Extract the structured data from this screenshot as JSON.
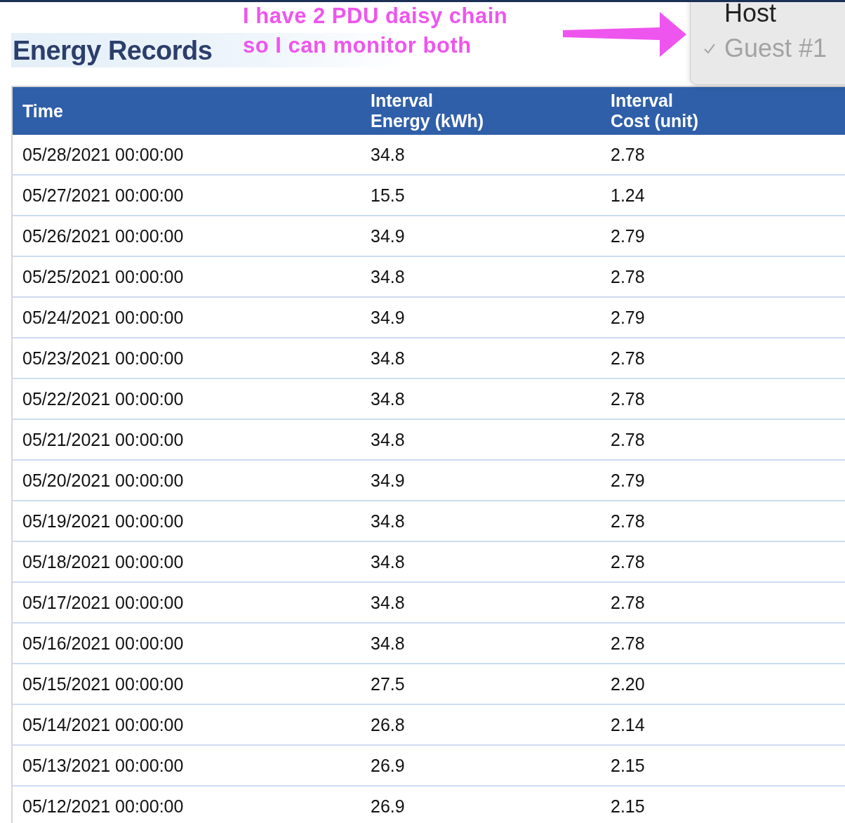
{
  "title": "Energy Records",
  "annotation": {
    "lines": [
      "I have 2 PDU daisy chain",
      "so I can monitor both"
    ]
  },
  "menu": {
    "items": [
      {
        "label": "Host",
        "checked": false
      },
      {
        "label": "Guest #1",
        "checked": true
      }
    ]
  },
  "table": {
    "columns": [
      "Time",
      "Interval\nEnergy (kWh)",
      "Interval\nCost (unit)"
    ],
    "rows": [
      [
        "05/28/2021 00:00:00",
        "34.8",
        "2.78"
      ],
      [
        "05/27/2021 00:00:00",
        "15.5",
        "1.24"
      ],
      [
        "05/26/2021 00:00:00",
        "34.9",
        "2.79"
      ],
      [
        "05/25/2021 00:00:00",
        "34.8",
        "2.78"
      ],
      [
        "05/24/2021 00:00:00",
        "34.9",
        "2.79"
      ],
      [
        "05/23/2021 00:00:00",
        "34.8",
        "2.78"
      ],
      [
        "05/22/2021 00:00:00",
        "34.8",
        "2.78"
      ],
      [
        "05/21/2021 00:00:00",
        "34.8",
        "2.78"
      ],
      [
        "05/20/2021 00:00:00",
        "34.9",
        "2.79"
      ],
      [
        "05/19/2021 00:00:00",
        "34.8",
        "2.78"
      ],
      [
        "05/18/2021 00:00:00",
        "34.8",
        "2.78"
      ],
      [
        "05/17/2021 00:00:00",
        "34.8",
        "2.78"
      ],
      [
        "05/16/2021 00:00:00",
        "34.8",
        "2.78"
      ],
      [
        "05/15/2021 00:00:00",
        "27.5",
        "2.20"
      ],
      [
        "05/14/2021 00:00:00",
        "26.8",
        "2.14"
      ],
      [
        "05/13/2021 00:00:00",
        "26.9",
        "2.15"
      ],
      [
        "05/12/2021 00:00:00",
        "26.9",
        "2.15"
      ]
    ]
  }
}
